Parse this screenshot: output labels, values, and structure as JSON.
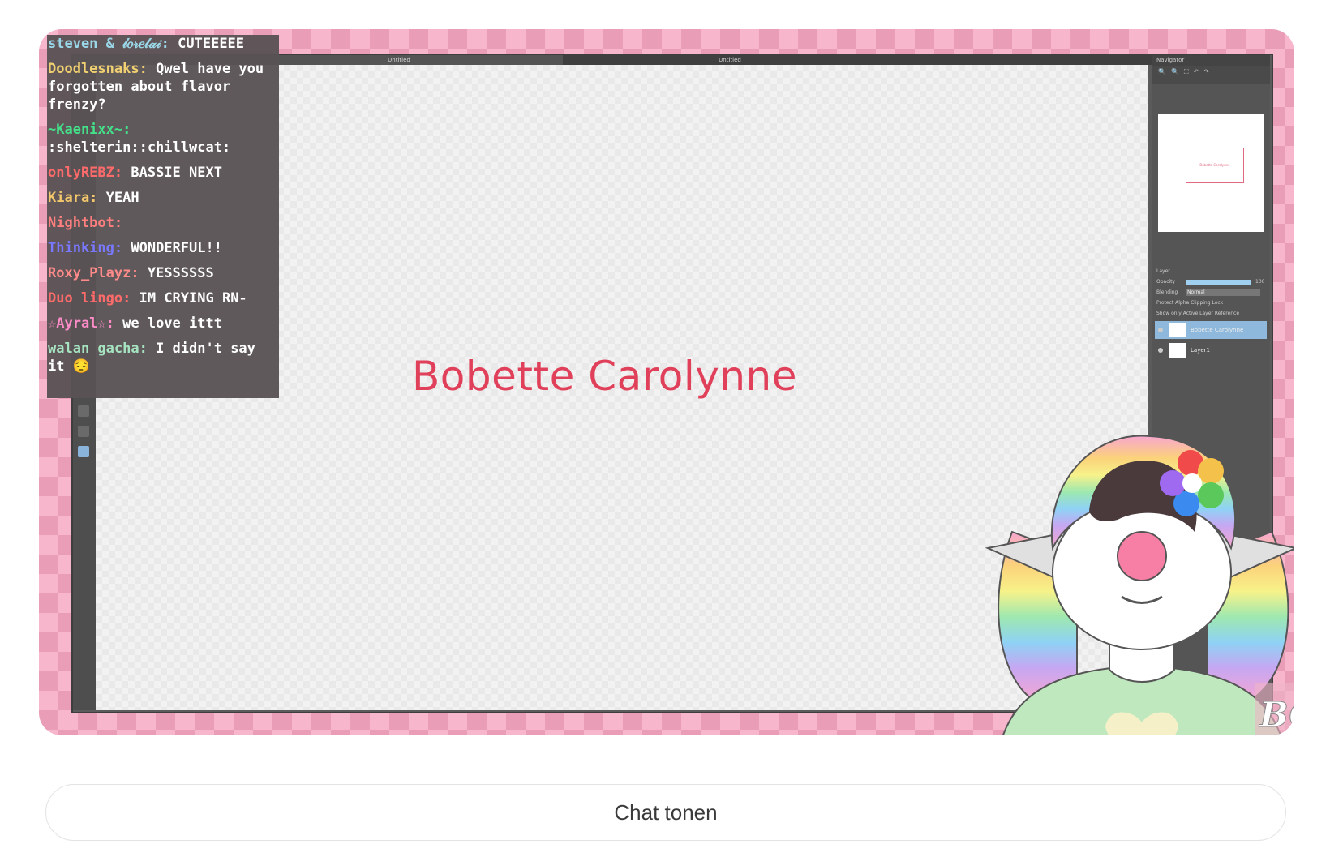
{
  "app": {
    "doc_tabs": [
      "Untitled",
      "Untitled"
    ],
    "panels": {
      "navigator": "Navigator",
      "layer": "Layer"
    },
    "layer_props": {
      "opacity_label": "Opacity",
      "opacity_value": "100",
      "blending_label": "Blending",
      "blending_value": "Normal",
      "options": [
        "Protect Alpha",
        "Clipping",
        "Lock"
      ],
      "options2": [
        "Show only Active Layer",
        "Reference"
      ]
    },
    "layers": [
      "Bobette Carolynne",
      "Layer1"
    ]
  },
  "canvas": {
    "title": "Bobette Carolynne"
  },
  "chat": {
    "messages": [
      {
        "user": "steven & 𝓁𝑜𝓇𝑒𝓁𝒶𝒾:",
        "text": "CUTEEEEE",
        "color": "#9ad7e8"
      },
      {
        "user": "Doodlesnaks:",
        "text": "Qwel have you forgotten about flavor frenzy?",
        "color": "#f0d070"
      },
      {
        "user": "~Kaenixx~:",
        "text": ":shelterin::chillwcat:",
        "color": "#44e08a"
      },
      {
        "user": "onlyREBZ:",
        "text": "BASSIE NEXT",
        "color": "#ff6a6a"
      },
      {
        "user": "Kiara:",
        "text": "YEAH",
        "color": "#f2c86b"
      },
      {
        "user": "Nightbot:",
        "text": "",
        "color": "#ff7f7f"
      },
      {
        "user": "Thinking:",
        "text": "WONDERFUL!!",
        "color": "#7a78ff"
      },
      {
        "user": "Roxy_Playz:",
        "text": "YESSSSSS",
        "color": "#ff8a8a"
      },
      {
        "user": "Duo lingo:",
        "text": "IM CRYING RN-",
        "color": "#ff6a6a"
      },
      {
        "user": "☆Ayral☆:",
        "text": "we love ittt",
        "color": "#ff8cc8"
      },
      {
        "user": "walan gacha:",
        "text": "I didn't say it 😔",
        "color": "#a6e3c0"
      }
    ]
  },
  "watermark": "BC",
  "chat_button": {
    "label": "Chat tonen"
  }
}
